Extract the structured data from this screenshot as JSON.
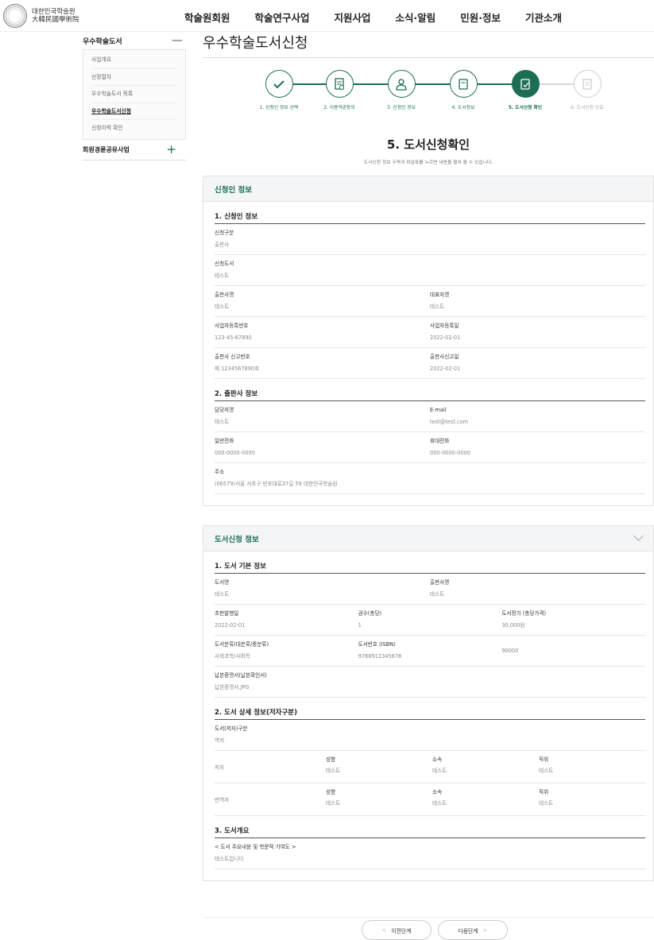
{
  "header": {
    "logo_text": [
      "대한민국학술원",
      "大韓民國學術院"
    ],
    "menu": [
      "학술원회원",
      "학술연구사업",
      "지원사업",
      "소식·알림",
      "민원·정보",
      "기관소개"
    ]
  },
  "sidebar": {
    "section": "우수학술도서",
    "collapse_icon": "—",
    "items": [
      "사업개요",
      "선정절차",
      "우수학술도서 목록",
      "우수학술도서신청",
      "신청이력 확인"
    ],
    "active_index": 3,
    "section2": "회원경륜공유사업",
    "expand_icon": "+"
  },
  "main": {
    "page_title": "우수학술도서신청",
    "steps": [
      {
        "label": "1. 신청인 정보 선택",
        "icon": "check-icon"
      },
      {
        "label": "2. 이용약관동의",
        "icon": "document-icon"
      },
      {
        "label": "3. 신청인 정보",
        "icon": "person-icon"
      },
      {
        "label": "4. 도서정보",
        "icon": "book-icon"
      },
      {
        "label": "5. 도서신청 확인",
        "icon": "confirm-icon"
      },
      {
        "label": "6. 도서신청 완료",
        "icon": "list-icon"
      }
    ],
    "current_step": 5,
    "section_title": "5. 도서신청확인",
    "section_desc": "도서신청 정보 우측의 화살표를 누르면 내용을 펼쳐 볼 수 있습니다."
  },
  "applicant_panel": {
    "title": "신청인 정보",
    "sub1": "1. 신청인 정보",
    "apply_type_label": "신청구분",
    "apply_type": "출판사",
    "apply_book_label": "신청도서",
    "apply_book": "테스트",
    "publisher_name_label": "출판사명",
    "publisher_name": "테스트",
    "ceo_label": "대표자명",
    "ceo": "테스트",
    "biz_no_label": "사업자등록번호",
    "biz_no": "123-45-67890",
    "biz_date_label": "사업자등록일",
    "biz_date": "2022-02-01",
    "report_no_label": "출판사 신고번호",
    "report_no": "제 1234567890호",
    "report_date_label": "출판사신고일",
    "report_date": "2022-02-01",
    "sub2": "2. 출판사 정보",
    "manager_label": "담당자명",
    "manager": "테스트",
    "email_label": "E-mail",
    "email": "test@test.com",
    "phone_label": "일반전화",
    "phone": "000-0000-0000",
    "mobile_label": "휴대전화",
    "mobile": "000-0000-0000",
    "address_label": "주소",
    "address": "(06579)서울 서초구 반포대로37길 59 대한민국학술원"
  },
  "book_panel": {
    "title": "도서신청 정보",
    "sub1": "1. 도서 기본 정보",
    "book_name_label": "도서명",
    "book_name": "테스트",
    "publisher_label": "출판사명",
    "publisher": "테스트",
    "first_pub_label": "초판발행일",
    "first_pub": "2022-02-01",
    "volumes_label": "권수(총당)",
    "volumes": "1",
    "price_label": "도서정가 (총당가격)",
    "price": "30,000원",
    "category_label": "도서분류(대분류/중분류)",
    "category": "사회과학/사회학",
    "isbn_label": "도서번호 (ISBN)",
    "isbn": "9788912345678",
    "extra_value": "90000",
    "deposit_label": "납본증명서(납본확인서)",
    "deposit": "납본증명서.JPG",
    "sub2": "2. 도서 상세 정보(저자구분)",
    "author_type_label": "도서(저자)구분",
    "author_type": "역저",
    "author_rows": [
      {
        "role": "저자",
        "name_label": "성함",
        "name": "테스트",
        "org_label": "소속",
        "org": "테스트",
        "pos_label": "직위",
        "pos": "테스트"
      },
      {
        "role": "번역자",
        "name_label": "성함",
        "name": "테스트",
        "org_label": "소속",
        "org": "테스트",
        "pos_label": "직위",
        "pos": "테스트"
      }
    ],
    "sub3": "3. 도서개요",
    "summary_label": "< 도서 주요내용 및 학문적 기여도 >",
    "summary": "테스트입니다"
  },
  "buttons": {
    "prev": "이전단계",
    "next": "다음단계"
  }
}
